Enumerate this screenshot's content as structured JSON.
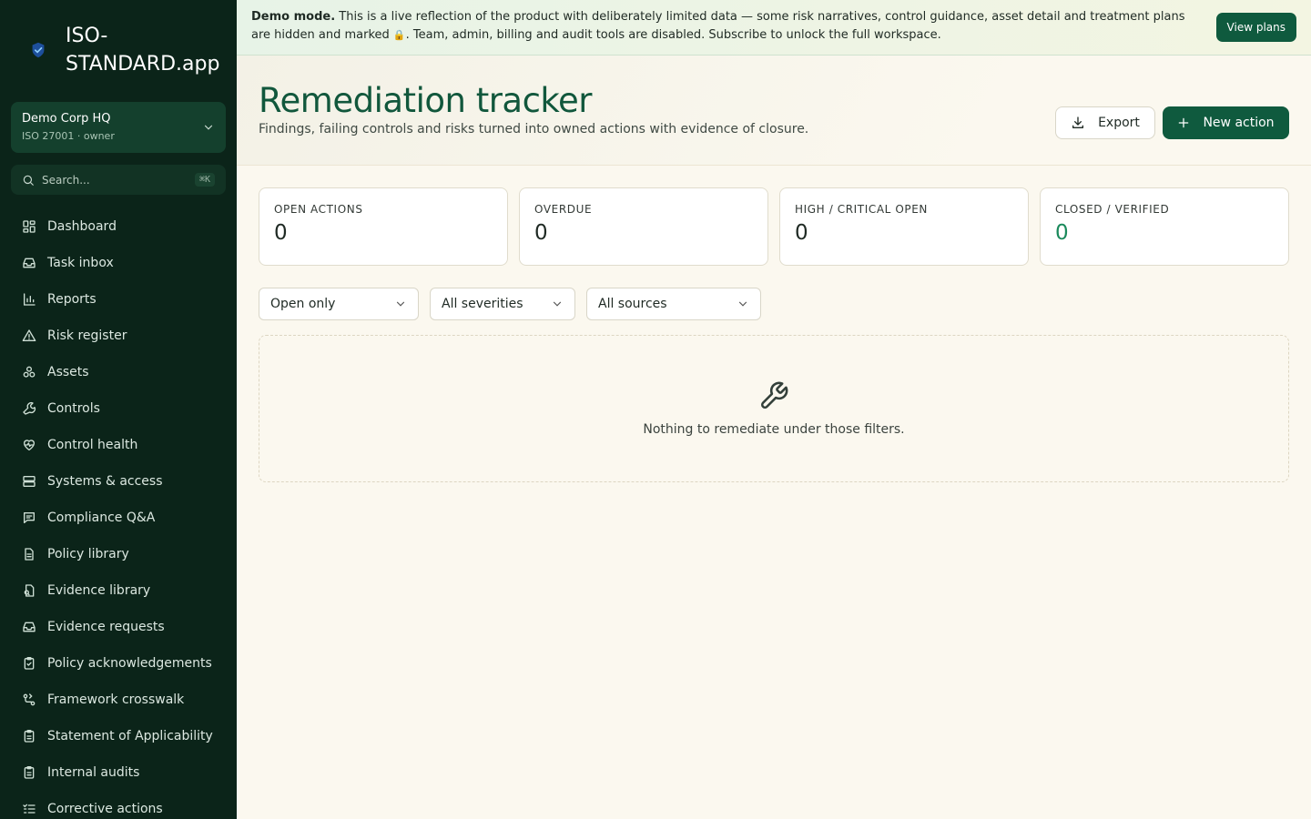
{
  "brand": {
    "name": "ISO-STANDARD.app"
  },
  "workspace": {
    "name": "Demo Corp HQ",
    "subtitle": "ISO 27001 · owner"
  },
  "search": {
    "placeholder": "Search...",
    "shortcut": "⌘K"
  },
  "sidebar": {
    "items": [
      {
        "label": "Dashboard",
        "icon": "dashboard-icon"
      },
      {
        "label": "Task inbox",
        "icon": "inbox-icon"
      },
      {
        "label": "Reports",
        "icon": "bar-chart-icon"
      },
      {
        "label": "Risk register",
        "icon": "warning-triangle-icon"
      },
      {
        "label": "Assets",
        "icon": "boxes-icon"
      },
      {
        "label": "Controls",
        "icon": "wrench-icon"
      },
      {
        "label": "Control health",
        "icon": "heart-pulse-icon"
      },
      {
        "label": "Systems & access",
        "icon": "server-icon"
      },
      {
        "label": "Compliance Q&A",
        "icon": "chat-icon"
      },
      {
        "label": "Policy library",
        "icon": "document-icon"
      },
      {
        "label": "Evidence library",
        "icon": "evidence-icon"
      },
      {
        "label": "Evidence requests",
        "icon": "inbox-icon"
      },
      {
        "label": "Policy acknowledgements",
        "icon": "clipboard-check-icon"
      },
      {
        "label": "Framework crosswalk",
        "icon": "crosswalk-icon"
      },
      {
        "label": "Statement of Applicability",
        "icon": "clipboard-icon"
      },
      {
        "label": "Internal audits",
        "icon": "clipboard-icon"
      },
      {
        "label": "Corrective actions",
        "icon": "checklist-icon"
      }
    ]
  },
  "banner": {
    "lead": "Demo mode.",
    "text": " This is a live reflection of the product with deliberately limited data — some risk narratives, control guidance, asset detail and treatment plans are hidden and marked ",
    "lock_glyph": "🔒",
    "text_after": ". Team, admin, billing and audit tools are disabled. Subscribe to unlock the full workspace.",
    "button": "View plans"
  },
  "header": {
    "title": "Remediation tracker",
    "subtitle": "Findings, failing controls and risks turned into owned actions with evidence of closure.",
    "export_label": "Export",
    "new_label": "New action"
  },
  "stats": [
    {
      "label": "OPEN ACTIONS",
      "value": "0"
    },
    {
      "label": "OVERDUE",
      "value": "0"
    },
    {
      "label": "HIGH / CRITICAL OPEN",
      "value": "0"
    },
    {
      "label": "CLOSED / VERIFIED",
      "value": "0"
    }
  ],
  "filters": {
    "status": "Open only",
    "severity": "All severities",
    "source": "All sources"
  },
  "empty_state": {
    "text": "Nothing to remediate under those filters."
  },
  "colors": {
    "sidebar": "#0b2419",
    "accent": "#0f5a3e",
    "success": "#1b8a5c",
    "background": "#fbf8ef"
  }
}
